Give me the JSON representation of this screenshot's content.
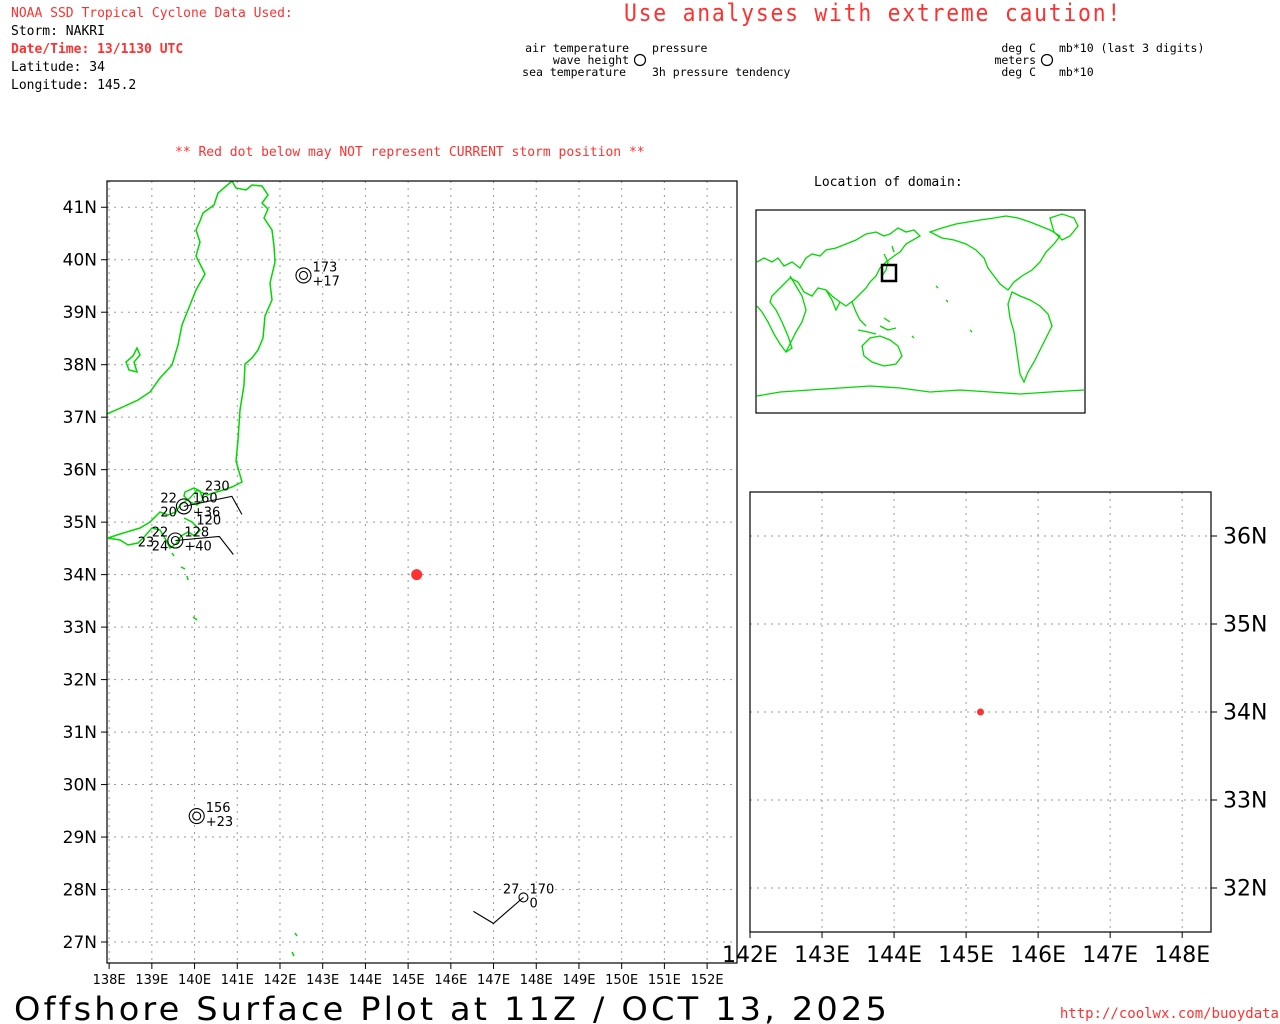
{
  "colors": {
    "red": "#ff3030",
    "coast": "#00d800",
    "grid": "#9a9a9a",
    "ink": "#000000"
  },
  "header": {
    "source_title": "NOAA SSD Tropical Cyclone Data Used:",
    "storm": "Storm: NAKRI",
    "datetime": "Date/Time: 13/1130 UTC",
    "latitude": "Latitude: 34",
    "longitude": "Longitude: 145.2",
    "warning": "Use analyses with extreme caution!",
    "red_dot_note": "** Red dot below may NOT represent CURRENT storm position **"
  },
  "legend": {
    "left": {
      "air_temperature": "air temperature",
      "wave_height": "wave height",
      "sea_temperature": "sea temperature",
      "pressure": "pressure",
      "pressure_tendency": "3h pressure tendency"
    },
    "right": {
      "deg_c_top": "deg C",
      "meters": "meters",
      "deg_c_bottom": "deg C",
      "pressure_units": "mb*10 (last 3 digits)",
      "tendency_units": "mb*10"
    }
  },
  "inset": {
    "title": "Location of domain:"
  },
  "main_map": {
    "lat_labels": [
      "41N",
      "40N",
      "39N",
      "38N",
      "37N",
      "36N",
      "35N",
      "34N",
      "33N",
      "32N",
      "31N",
      "30N",
      "29N",
      "28N",
      "27N"
    ],
    "lat_values": [
      41,
      40,
      39,
      38,
      37,
      36,
      35,
      34,
      33,
      32,
      31,
      30,
      29,
      28,
      27
    ],
    "lon_labels": [
      "138E",
      "139E",
      "140E",
      "141E",
      "142E",
      "143E",
      "144E",
      "145E",
      "146E",
      "147E",
      "148E",
      "149E",
      "150E",
      "151E",
      "152E"
    ],
    "lon_values": [
      138,
      139,
      140,
      141,
      142,
      143,
      144,
      145,
      146,
      147,
      148,
      149,
      150,
      151,
      152
    ],
    "lon_range": [
      137.95,
      152.7
    ],
    "lat_range": [
      26.6,
      41.5
    ],
    "storm_position": {
      "lon": 145.2,
      "lat": 34
    }
  },
  "stations": [
    {
      "id": "st-173",
      "lon": 142.55,
      "lat": 39.7,
      "type": "double",
      "pressure": "173",
      "tendency": "+17"
    },
    {
      "id": "st-160",
      "lon": 139.75,
      "lat": 35.3,
      "type": "double",
      "pressure": "160",
      "tendency": "+36",
      "air": "22",
      "sea": "20",
      "extra": "230"
    },
    {
      "id": "st-128",
      "lon": 139.55,
      "lat": 34.65,
      "type": "double",
      "pressure": "128",
      "tendency": "+40",
      "air": "22",
      "sea": "24",
      "extra": "120",
      "extra2": "23"
    },
    {
      "id": "st-156",
      "lon": 140.05,
      "lat": 29.4,
      "type": "double",
      "pressure": "156",
      "tendency": "+23"
    },
    {
      "id": "st-170",
      "lon": 147.7,
      "lat": 27.85,
      "type": "single",
      "pressure": "170",
      "tendency": "0",
      "air": "27"
    }
  ],
  "zoom_map": {
    "lat_labels": [
      "36N",
      "35N",
      "34N",
      "33N",
      "32N"
    ],
    "lat_values": [
      36,
      35,
      34,
      33,
      32
    ],
    "lon_labels": [
      "142E",
      "143E",
      "144E",
      "145E",
      "146E",
      "147E",
      "148E"
    ],
    "lon_values": [
      142,
      143,
      144,
      145,
      146,
      147,
      148
    ],
    "lon_range": [
      142.0,
      148.4
    ],
    "lat_range": [
      31.5,
      36.5
    ],
    "storm_position": {
      "lon": 145.2,
      "lat": 34
    }
  },
  "footer": {
    "title": "Offshore Surface Plot at 11Z / OCT 13, 2025",
    "url": "http://coolwx.com/buoydata"
  }
}
